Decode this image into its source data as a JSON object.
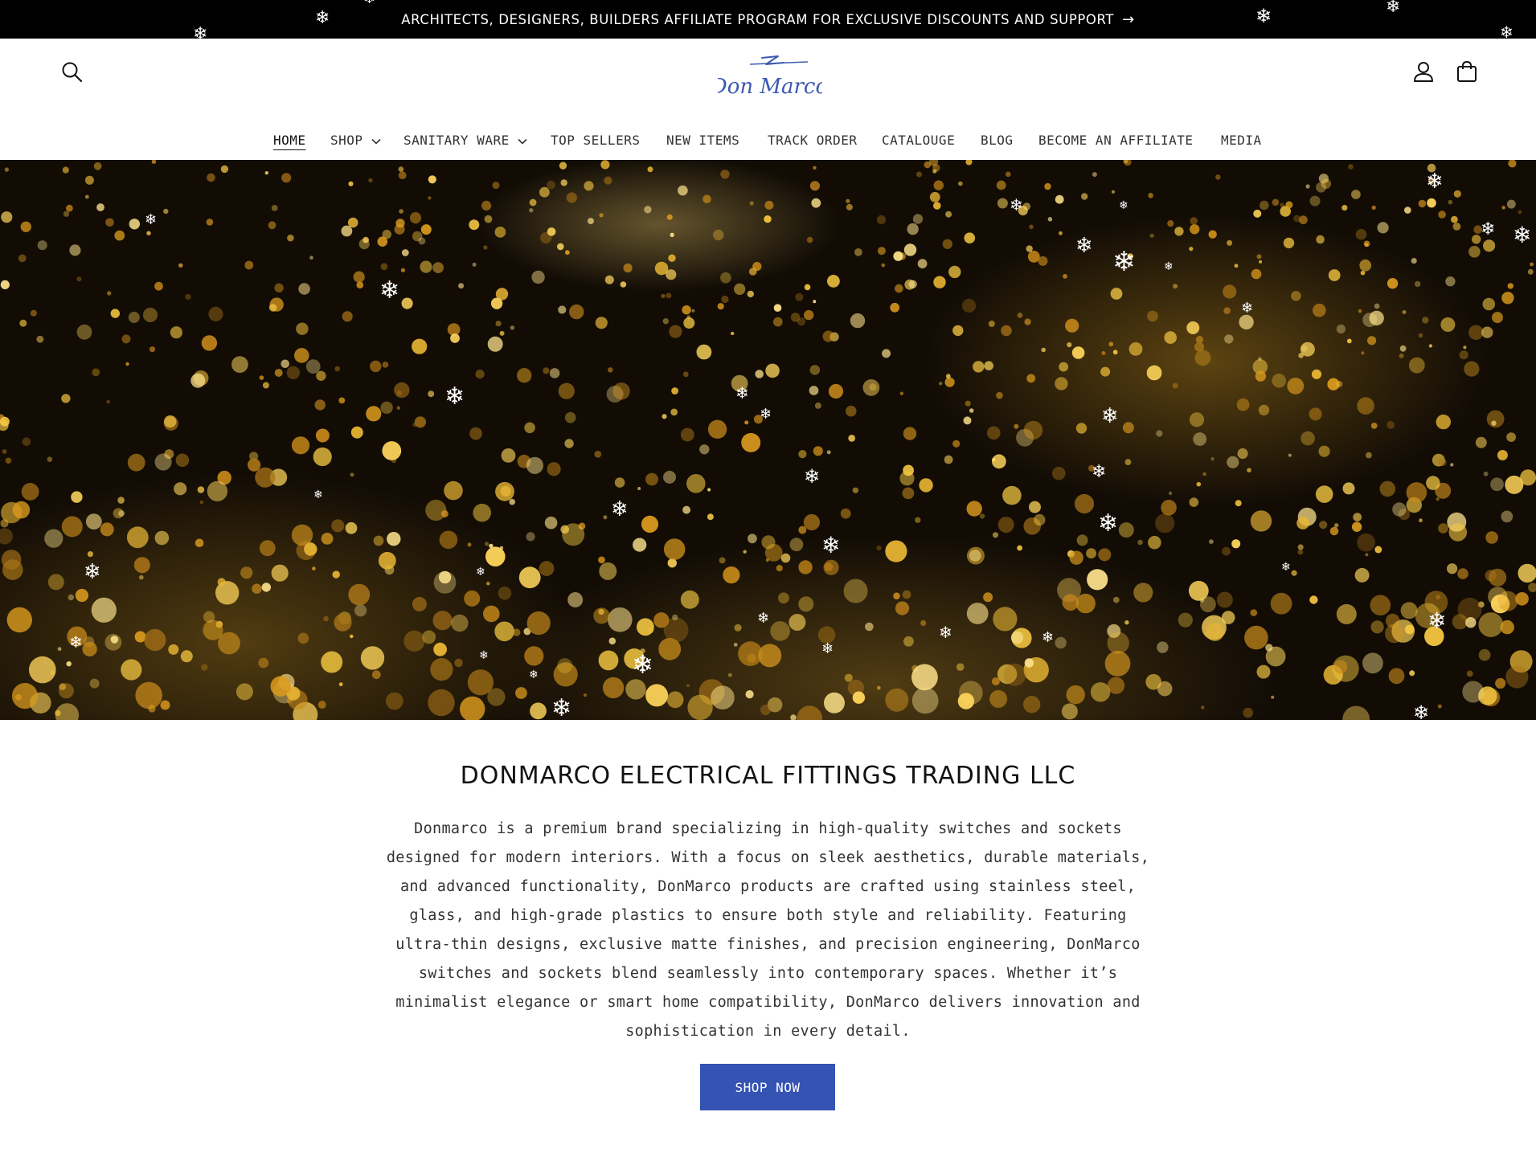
{
  "announcement": {
    "text": "ARCHITECTS, DESIGNERS, BUILDERS AFFILIATE PROGRAM FOR EXCLUSIVE DISCOUNTS AND SUPPORT",
    "arrow_icon": "arrow-right-icon"
  },
  "header": {
    "search_icon": "search-icon",
    "logo_text": "Don Marco",
    "account_icon": "account-icon",
    "cart_icon": "cart-icon"
  },
  "nav": {
    "items": [
      {
        "label": "HOME",
        "active": true
      },
      {
        "label": "SHOP",
        "dropdown": true
      },
      {
        "label": "SANITARY WARE",
        "dropdown": true
      },
      {
        "label": "TOP SELLERS"
      },
      {
        "label": "NEW ITEMS"
      },
      {
        "label": "TRACK ORDER"
      },
      {
        "label": "CATALOUGE"
      },
      {
        "label": "BLOG"
      },
      {
        "label": "BECOME AN AFFILIATE"
      },
      {
        "label": "MEDIA"
      }
    ]
  },
  "hero": {
    "media": "gold glitter particles video",
    "overlay_icon": "snowflake-icon"
  },
  "about": {
    "title": "DONMARCO ELECTRICAL FITTINGS TRADING LLC",
    "body_lines": [
      "Donmarco is a premium brand specializing in high-quality switches and sockets",
      "designed for modern interiors. With a focus on sleek aesthetics, durable materials,",
      "and advanced functionality, DonMarco products are crafted using stainless steel,",
      "glass, and high-grade plastics to ensure both style and reliability. Featuring",
      "ultra-thin designs, exclusive matte finishes, and precision engineering, DonMarco",
      "switches and sockets blend seamlessly into contemporary spaces. Whether it’s",
      "minimalist elegance or smart home compatibility, DonMarco delivers innovation and",
      "sophistication in every detail."
    ],
    "button_label": "SHOP NOW"
  },
  "colors": {
    "announcement_bg": "#000000",
    "button_bg": "#3553b3",
    "logo": "#3b5ab0",
    "hero_bg": "#120c05",
    "gold": "#e8b534"
  }
}
